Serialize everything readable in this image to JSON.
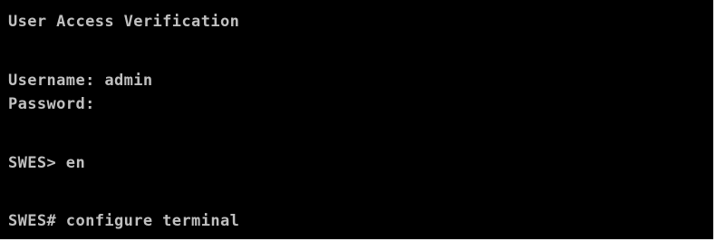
{
  "terminal": {
    "background": "#000000",
    "text_color": "#c0c0c0",
    "lines": {
      "banner": "User Access Verification",
      "username": "Username: admin",
      "password": "Password:",
      "enable": "SWES> en",
      "configure": "SWES# configure terminal"
    }
  }
}
